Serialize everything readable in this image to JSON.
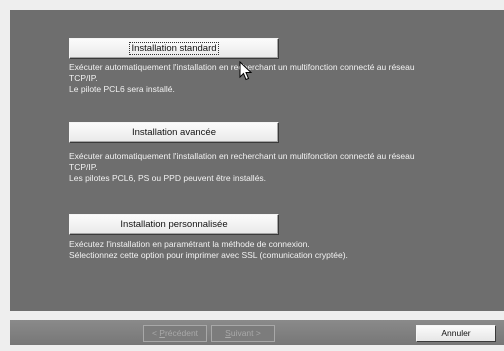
{
  "options": [
    {
      "button_label": "Installation standard",
      "description": [
        "Exécuter automatiquement l'installation en recherchant un multifonction connecté au réseau",
        "TCP/IP.",
        "Le pilote PCL6 sera installé."
      ]
    },
    {
      "button_label": "Installation avancée",
      "description": [
        "Exécuter automatiquement l'installation en recherchant un multifonction connecté au réseau",
        "TCP/IP.",
        "Les pilotes PCL6, PS ou PPD peuvent être installés."
      ]
    },
    {
      "button_label": "Installation personnalisée",
      "description": [
        "Exécutez l'installation en paramétrant la méthode de connexion.",
        "Sélectionnez cette option pour imprimer avec SSL (comunication cryptée)."
      ]
    }
  ],
  "footer": {
    "back_label_prefix": "< ",
    "back_label_mnemonic": "P",
    "back_label_rest": "récédent",
    "next_label_mnemonic": "S",
    "next_label_rest": "uivant >",
    "cancel_label": "Annuler"
  }
}
